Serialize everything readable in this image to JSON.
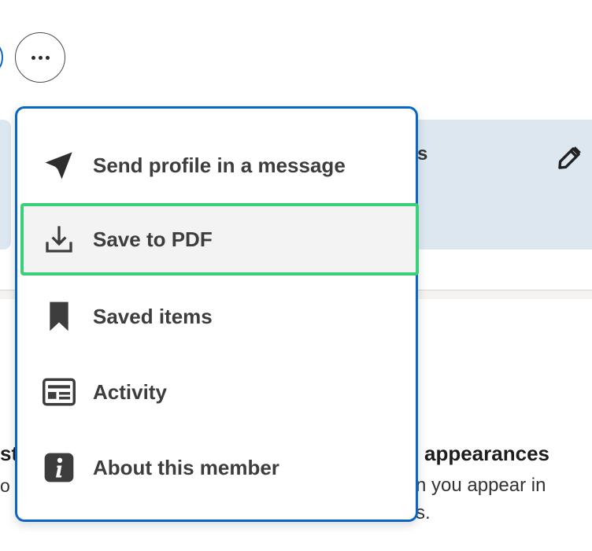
{
  "header": {
    "more_button_icon": "ellipsis-horizontal-icon"
  },
  "background": {
    "card_peek_letter": "s",
    "edit_icon": "pencil-icon",
    "left_section_title": "st",
    "left_section_text": "o",
    "right_section_title": "appearances",
    "right_section_text_line1": "n you appear in",
    "right_section_text_line2": "s."
  },
  "menu": {
    "items": [
      {
        "label": "Send profile in a message",
        "icon": "send-icon"
      },
      {
        "label": "Save to PDF",
        "icon": "download-icon",
        "highlighted": true
      },
      {
        "label": "Saved items",
        "icon": "bookmark-icon"
      },
      {
        "label": "Activity",
        "icon": "activity-icon"
      },
      {
        "label": "About this member",
        "icon": "info-icon"
      }
    ]
  },
  "colors": {
    "accent": "#0a66c2",
    "highlight_border": "#3ccf7a",
    "card_background": "#dde7f0",
    "icon_color": "#3d3d3d"
  }
}
